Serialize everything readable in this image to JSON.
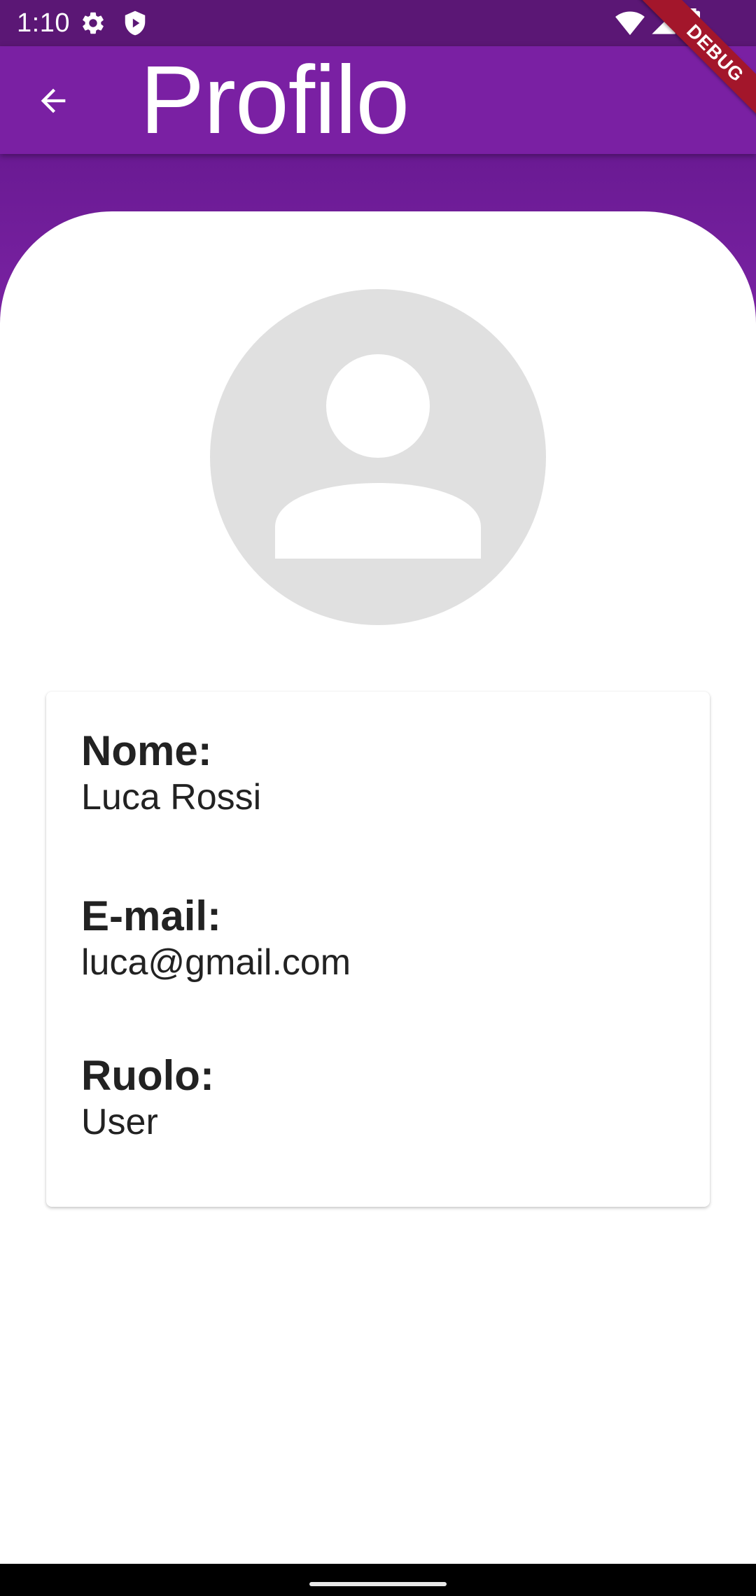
{
  "status_bar": {
    "time": "1:10",
    "icons": [
      "gear-icon",
      "shield-play-icon",
      "wifi-icon",
      "signal-icon",
      "battery-icon"
    ]
  },
  "app_bar": {
    "title": "Profilo",
    "back_icon": "arrow-back-icon"
  },
  "debug_banner": "DEBUG",
  "profile": {
    "avatar_icon": "person-icon",
    "fields": [
      {
        "label": "Nome:",
        "value": "Luca Rossi"
      },
      {
        "label": "E-mail:",
        "value": "luca@gmail.com"
      },
      {
        "label": "Ruolo:",
        "value": "User"
      }
    ]
  },
  "colors": {
    "status_bar": "#5b1775",
    "app_bar": "#7a20a3",
    "avatar_bg": "#e0e0e0",
    "debug_ribbon": "#a3162b"
  }
}
